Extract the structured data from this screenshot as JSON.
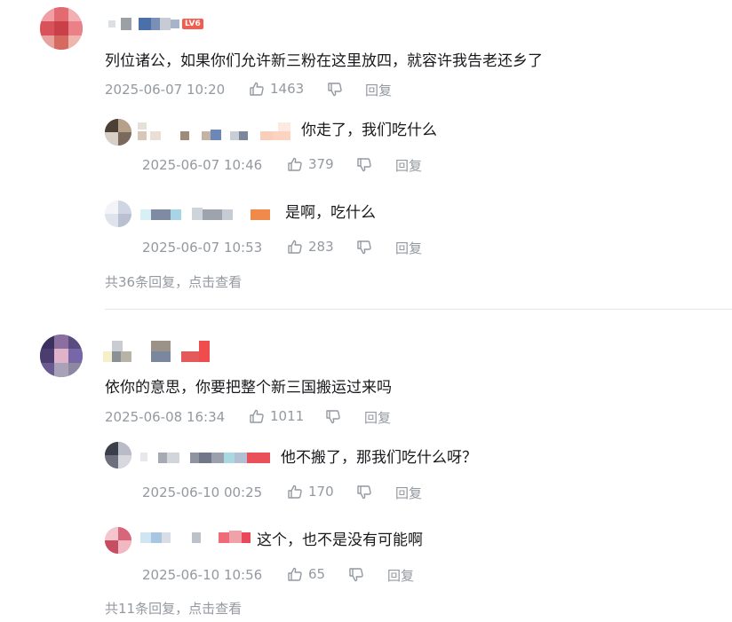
{
  "threads": [
    {
      "text": "列位诸公，如果你们允许新三粉在这里放四，就容许我告老还乡了",
      "time": "2025-06-07 10:20",
      "likes": "1463",
      "reply_label": "回复",
      "level_badge": "LV6",
      "replies": [
        {
          "text": "你走了，我们吃什么",
          "time": "2025-06-07 10:46",
          "likes": "379",
          "reply_label": "回复"
        },
        {
          "text": "是啊，吃什么",
          "time": "2025-06-07 10:53",
          "likes": "283",
          "reply_label": "回复"
        }
      ],
      "more_label": "共36条回复，点击查看"
    },
    {
      "text": "依你的意思，你要把整个新三国搬运过来吗",
      "time": "2025-06-08 16:34",
      "likes": "1011",
      "reply_label": "回复",
      "replies": [
        {
          "text": "他不搬了，那我们吃什么呀？",
          "time": "2025-06-10 00:25",
          "likes": "170",
          "reply_label": "回复"
        },
        {
          "text": "这个，也不是没有可能啊",
          "time": "2025-06-10 10:56",
          "likes": "65",
          "reply_label": "回复"
        }
      ],
      "more_label": "共11条回复，点击查看"
    }
  ],
  "icons": {
    "like": "thumb-up-icon",
    "dislike": "thumb-down-icon"
  },
  "colors": {
    "meta": "#9499a0",
    "text": "#18191c",
    "badge": "#f25d4f"
  }
}
